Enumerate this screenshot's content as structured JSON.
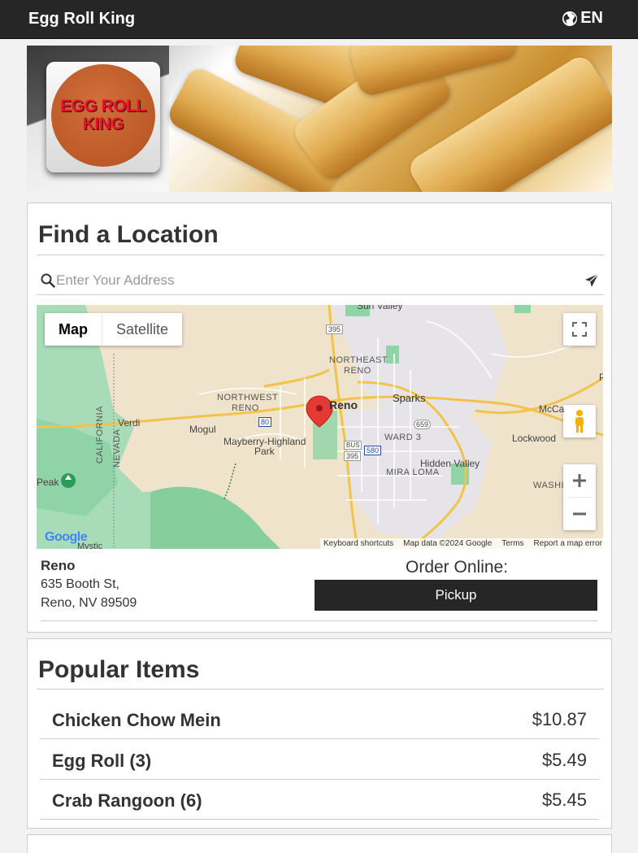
{
  "header": {
    "brand": "Egg Roll King",
    "language": "EN",
    "globe_icon": "globe-icon"
  },
  "hero": {
    "logo_line1": "EGG ROLL",
    "logo_line2": "KING"
  },
  "find_location": {
    "title": "Find a Location",
    "search_placeholder": "Enter Your Address",
    "search_value": "",
    "search_icon": "search-icon",
    "send_icon": "paper-plane-icon"
  },
  "map": {
    "type_map": "Map",
    "type_satellite": "Satellite",
    "selected_type": "Map",
    "labels": {
      "sun_valley": "Sun Valley",
      "northeast": "NORTHEAST",
      "reno_ne": "RENO",
      "northwest": "NORTHWEST",
      "reno_nw": "RENO",
      "reno": "Reno",
      "sparks": "Sparks",
      "verdi": "Verdi",
      "mogul": "Mogul",
      "mayberry": "Mayberry-Highland",
      "park": "Park",
      "ward3": "WARD 3",
      "hidden_valley": "Hidden Valley",
      "lockwood": "Lockwood",
      "mccarran": "McCa",
      "mira_loma": "MIRA LOMA",
      "washoe": "WASHI",
      "california": "CALIFORNIA",
      "nevada": "NEVADA",
      "peak": "Peak",
      "mystic": "Mystic",
      "r395a": "395",
      "r80": "80",
      "r659": "659",
      "r395b": "395",
      "r580": "580",
      "bus": "BUS",
      "p": "P"
    },
    "google": "Google",
    "footer": [
      "Keyboard shortcuts",
      "Map data ©2024 Google",
      "Terms",
      "Report a map error"
    ]
  },
  "store": {
    "name": "Reno",
    "address_line1": "635 Booth St,",
    "address_line2": "Reno, NV 89509",
    "order_label": "Order Online:",
    "pickup_label": "Pickup"
  },
  "popular": {
    "title": "Popular Items",
    "items": [
      {
        "name": "Chicken Chow Mein",
        "price": "$10.87"
      },
      {
        "name": "Egg Roll (3)",
        "price": "$5.49"
      },
      {
        "name": "Crab Rangoon (6)",
        "price": "$5.45"
      }
    ]
  },
  "colors": {
    "header_bg": "#262626",
    "button_bg": "#262626",
    "map_pin": "#e53935",
    "map_land": "#efe3cc",
    "map_park": "#8fd3a6"
  }
}
